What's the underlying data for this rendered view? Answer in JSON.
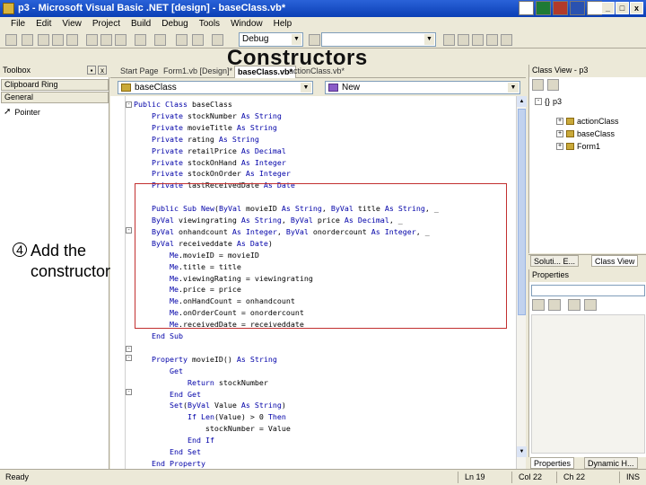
{
  "window": {
    "title": "p3 - Microsoft Visual Basic .NET [design] - baseClass.vb*",
    "controls": [
      "_",
      "□",
      "x"
    ]
  },
  "menu": [
    "File",
    "Edit",
    "View",
    "Project",
    "Build",
    "Debug",
    "Tools",
    "Window",
    "Help"
  ],
  "toolbar": {
    "config": "Debug"
  },
  "headline": "Constructors",
  "toolbox": {
    "title": "Toolbox",
    "sections": [
      "Clipboard Ring",
      "General"
    ],
    "pointer": "Pointer"
  },
  "annotation": {
    "number": "4",
    "line1": "Add the",
    "line2": "constructors"
  },
  "doc_tabs": [
    "Start Page",
    "Form1.vb [Design]*",
    "baseClass.vb*",
    "actionClass.vb*"
  ],
  "code_nav": {
    "left": "baseClass",
    "right": "New"
  },
  "code": [
    "Public Class baseClass",
    "    Private stockNumber As String",
    "    Private movieTitle As String",
    "    Private rating As String",
    "    Private retailPrice As Decimal",
    "    Private stockOnHand As Integer",
    "    Private stockOnOrder As Integer",
    "    Private lastReceivedDate As Date",
    "",
    "    Public Sub New(ByVal movieID As String, ByVal title As String, _",
    "    ByVal viewingrating As String, ByVal price As Decimal, _",
    "    ByVal onhandcount As Integer, ByVal onordercount As Integer, _",
    "    ByVal receiveddate As Date)",
    "        Me.movieID = movieID",
    "        Me.title = title",
    "        Me.viewingRating = viewingrating",
    "        Me.price = price",
    "        Me.onHandCount = onhandcount",
    "        Me.onOrderCount = onordercount",
    "        Me.receivedDate = receiveddate",
    "    End Sub",
    "",
    "    Property movieID() As String",
    "        Get",
    "            Return stockNumber",
    "        End Get",
    "        Set(ByVal Value As String)",
    "            If Len(Value) > 0 Then",
    "                stockNumber = Value",
    "            End If",
    "        End Set",
    "    End Property"
  ],
  "class_view": {
    "title": "Class View - p3",
    "root": "p3",
    "items": [
      "actionClass",
      "baseClass",
      "Form1"
    ]
  },
  "right_tabs_top": [
    "Soluti... E...",
    "Class View"
  ],
  "properties": {
    "title": "Properties"
  },
  "right_tabs_bottom": [
    "Properties",
    "Dynamic H..."
  ],
  "status": {
    "ready": "Ready",
    "line": "Ln 19",
    "col": "Col 22",
    "ch": "Ch 22",
    "mode": "INS"
  }
}
